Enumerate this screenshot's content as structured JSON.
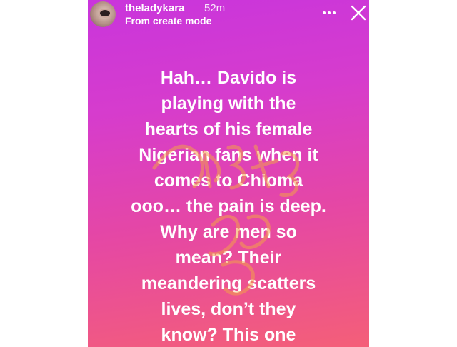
{
  "story": {
    "username": "theladykara",
    "time": "52m",
    "subtitle": "From create mode",
    "icons": {
      "more": "more-horizontal-icon",
      "close": "close-icon"
    },
    "text_lines": [
      "Hah… Davido is",
      "playing with the",
      "hearts of his female",
      "Nigerian fans when it",
      "comes to Chioma",
      "ooo… the pain is deep.",
      "Why are men so",
      "mean? Their",
      "meandering scatters",
      "lives, don’t they",
      "know? This one"
    ],
    "colors": {
      "gradient_top": "#c935dc",
      "gradient_bottom": "#f45f78",
      "text": "#ffffff"
    }
  }
}
